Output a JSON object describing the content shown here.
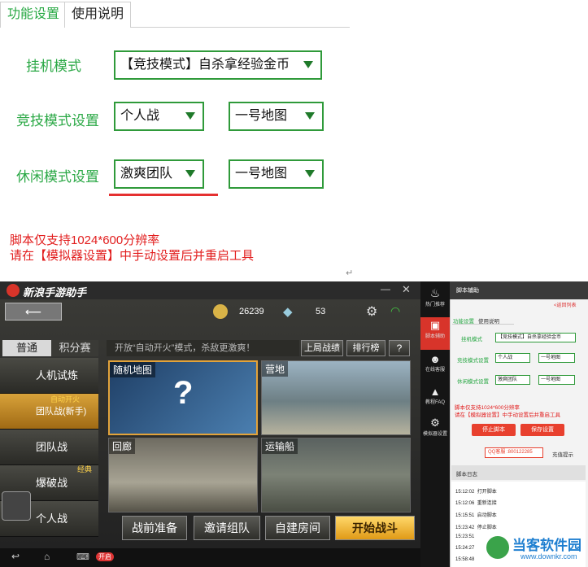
{
  "settings": {
    "tabs": [
      "功能设置",
      "使用说明"
    ],
    "rows": [
      {
        "label": "挂机模式",
        "dropdowns": [
          "【竞技模式】自杀拿经验金币"
        ]
      },
      {
        "label": "竞技模式设置",
        "dropdowns": [
          "个人战",
          "一号地图"
        ]
      },
      {
        "label": "休闲模式设置",
        "dropdowns": [
          "激爽团队",
          "一号地图"
        ]
      }
    ],
    "note_lines": [
      "脚本仅支持1024*600分辨率",
      "请在【模拟器设置】中手动设置后并重启工具"
    ],
    "corner_mark": "↵"
  },
  "emulator": {
    "title": "新浪手游助手",
    "coins": "26239",
    "diamonds": "53",
    "mode_tabs": [
      "普通",
      "积分赛"
    ],
    "banner": "开放“自动开火”模式，杀敌更激爽！",
    "top_buttons": [
      "上局战绩",
      "排行榜",
      "?"
    ],
    "left_items": [
      "人机试炼",
      "团队战(新手)",
      "团队战",
      "爆破战",
      "个人战"
    ],
    "left_tags": {
      "team_new": "自动开火",
      "blast": "经典"
    },
    "maps": [
      "随机地图",
      "营地",
      "回廊",
      "运输船"
    ],
    "bottom_buttons": [
      "战前准备",
      "邀请组队",
      "自建房间",
      "开始战斗"
    ],
    "android_toggle": "开启"
  },
  "sidebar": {
    "nav": [
      "热门推荐",
      "脚本辅助",
      "在线客服",
      "教程FAQ",
      "模拟器设置"
    ],
    "header": "脚本辅助",
    "back_link": "<返回列表",
    "tabs": [
      "功能设置",
      "使用说明"
    ],
    "rows": [
      {
        "label": "挂机模式",
        "dropdowns": [
          "【竞技模式】自杀拿经验金币"
        ]
      },
      {
        "label": "竞技模式设置",
        "dropdowns": [
          "个人战",
          "一号地图"
        ]
      },
      {
        "label": "休闲模式设置",
        "dropdowns": [
          "激爽团队",
          "一号地图"
        ]
      }
    ],
    "note_lines": [
      "脚本仅支持1024*600分辨率",
      "请在【模拟器设置】中手动设置后并重启工具"
    ],
    "stop_button": "停止脚本",
    "save_button": "保存设置",
    "qq": "QQ客服 :800122285",
    "tip": "充值提示",
    "log_title": "脚本日志",
    "logs": [
      {
        "time": "15:12:02",
        "text": "打开脚本"
      },
      {
        "time": "15:12:06",
        "text": "重新连接"
      },
      {
        "time": "15:15:51",
        "text": "启动脚本"
      },
      {
        "time": "15:23:42",
        "text": "停止脚本"
      },
      {
        "time": "15:23:51",
        "text": ""
      },
      {
        "time": "15:24:27",
        "text": ""
      },
      {
        "time": "15:58:48",
        "text": ""
      }
    ]
  },
  "watermark": {
    "name": "当客软件园",
    "url": "www.downkr.com"
  }
}
